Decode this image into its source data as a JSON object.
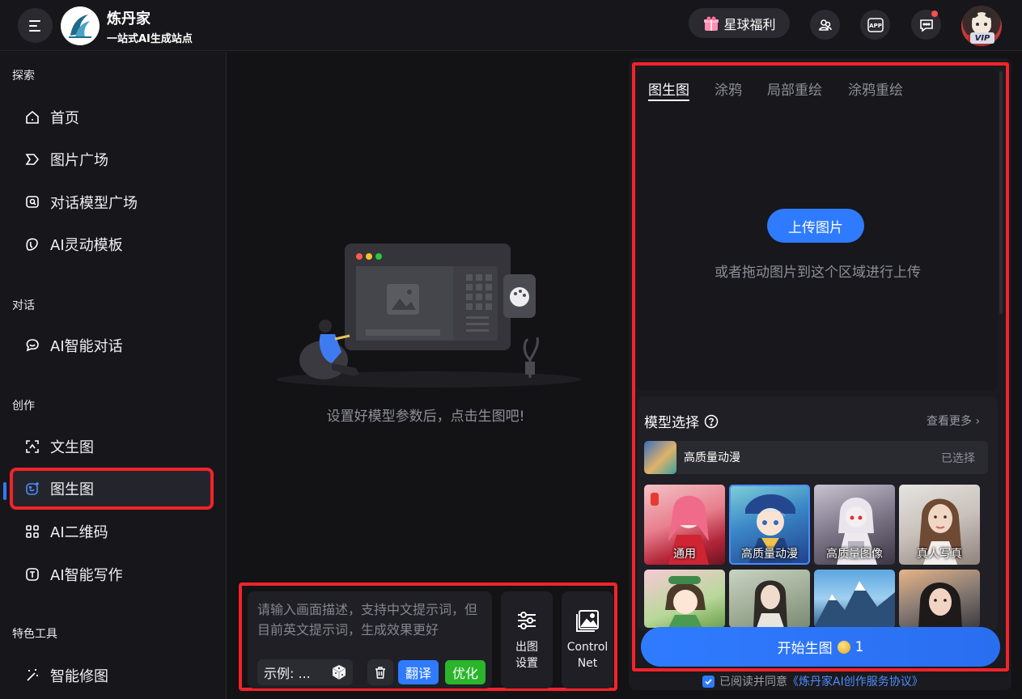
{
  "header": {
    "brand_name": "炼丹家",
    "brand_sub": "一站式AI生成站点",
    "welfare_label": "星球福利",
    "app_label": "APP",
    "vip_label": "VIP"
  },
  "sidebar": {
    "sections": [
      {
        "title": "探索"
      },
      {
        "title": "对话"
      },
      {
        "title": "创作"
      },
      {
        "title": "特色工具"
      }
    ],
    "items": [
      {
        "label": "首页",
        "icon": "home-icon"
      },
      {
        "label": "图片广场",
        "icon": "tag-icon"
      },
      {
        "label": "对话模型广场",
        "icon": "chat-search-icon"
      },
      {
        "label": "AI灵动模板",
        "icon": "template-icon"
      },
      {
        "label": "AI智能对话",
        "icon": "chat-bubble-icon"
      },
      {
        "label": "文生图",
        "icon": "text-to-image-icon"
      },
      {
        "label": "图生图",
        "icon": "image-to-image-icon",
        "active": true
      },
      {
        "label": "AI二维码",
        "icon": "qrcode-icon"
      },
      {
        "label": "AI智能写作",
        "icon": "writing-icon"
      },
      {
        "label": "智能修图",
        "icon": "magic-wand-icon"
      }
    ]
  },
  "center": {
    "empty_text": "设置好模型参数后，点击生图吧!",
    "prompt_placeholder": "请输入画面描述，支持中文提示词，但目前英文提示词，生成效果更好",
    "example_label": "示例: ...",
    "translate_label": "翻译",
    "optimize_label": "优化",
    "settings_label_1": "出图",
    "settings_label_2": "设置",
    "controlnet_label_1": "Control",
    "controlnet_label_2": "Net"
  },
  "right": {
    "tabs": [
      "图生图",
      "涂鸦",
      "局部重绘",
      "涂鸦重绘"
    ],
    "active_tab": 0,
    "upload_label": "上传图片",
    "upload_hint": "或者拖动图片到这个区域进行上传",
    "model_title": "模型选择",
    "view_more": "查看更多",
    "selected_model": "高质量动漫",
    "selected_status": "已选择",
    "models": [
      {
        "label": "通用"
      },
      {
        "label": "高质量动漫"
      },
      {
        "label": "高质量图像"
      },
      {
        "label": "真人写真"
      },
      {
        "label": ""
      },
      {
        "label": ""
      },
      {
        "label": ""
      },
      {
        "label": ""
      }
    ],
    "start_label": "开始生图",
    "cost": "1",
    "agree_text": "已阅读并同意",
    "agree_link": "《炼丹家AI创作服务协议》"
  },
  "colors": {
    "accent": "#2f7bff",
    "highlight_border": "#f4232a",
    "optimize_green": "#2ab52a",
    "background": "#131316"
  }
}
